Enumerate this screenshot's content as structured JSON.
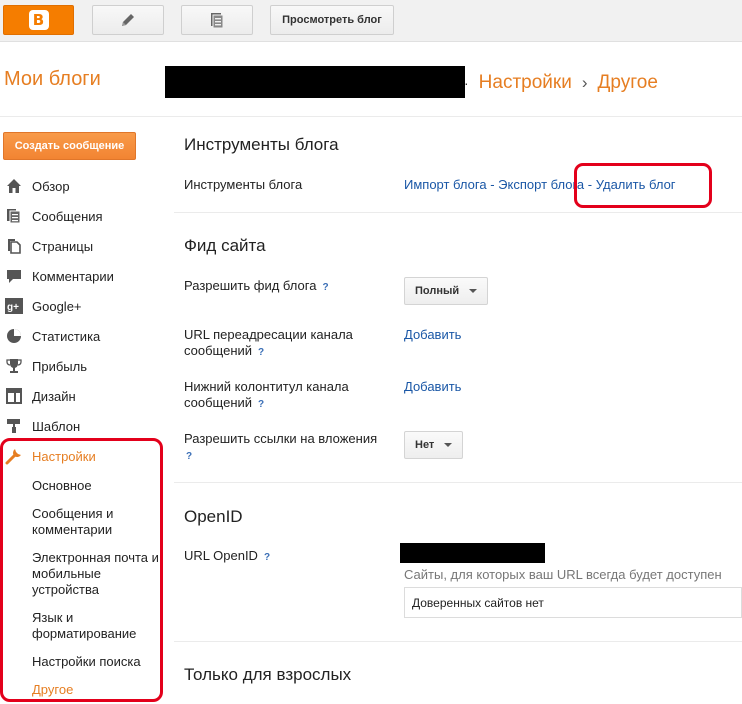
{
  "toolbar": {
    "logo_letter": "B",
    "view_blog_label": "Просмотреть блог"
  },
  "header": {
    "my_blogs": "Мои блоги",
    "breadcrumb": [
      "Настройки",
      "Другое"
    ],
    "breadcrumb_sep": "›",
    "dot": "·"
  },
  "sidebar": {
    "create_post": "Создать сообщение",
    "items": [
      {
        "label": "Обзор",
        "icon": "home-icon"
      },
      {
        "label": "Сообщения",
        "icon": "posts-icon"
      },
      {
        "label": "Страницы",
        "icon": "pages-icon"
      },
      {
        "label": "Комментарии",
        "icon": "comments-icon"
      },
      {
        "label": "Google+",
        "icon": "google-plus-icon"
      },
      {
        "label": "Статистика",
        "icon": "stats-icon"
      },
      {
        "label": "Прибыль",
        "icon": "trophy-icon"
      },
      {
        "label": "Дизайн",
        "icon": "layout-icon"
      },
      {
        "label": "Шаблон",
        "icon": "template-icon"
      },
      {
        "label": "Настройки",
        "icon": "wrench-icon"
      }
    ],
    "sub_items": [
      "Основное",
      "Сообщения и комментарии",
      "Электронная почта и мобильные устройства",
      "Язык и форматирование",
      "Настройки поиска",
      "Другое"
    ]
  },
  "main": {
    "blog_tools": {
      "title": "Инструменты блога",
      "label": "Инструменты блога",
      "import": "Импорт блога",
      "export": "Экспорт блога",
      "delete": "Удалить блог",
      "dash": "-"
    },
    "site_feed": {
      "title": "Фид сайта",
      "allow_feed_label": "Разрешить фид блога",
      "allow_feed_value": "Полный",
      "redirect_label": "URL переадресации канала сообщений",
      "redirect_link": "Добавить",
      "footer_label": "Нижний колонтитул канала сообщений",
      "footer_link": "Добавить",
      "enclosure_label": "Разрешить ссылки на вложения",
      "enclosure_value": "Нет",
      "help": "?"
    },
    "openid": {
      "title": "OpenID",
      "url_label": "URL OpenID",
      "note": "Сайты, для которых ваш URL всегда будет доступен",
      "trusted": "Доверенных сайтов нет",
      "help": "?"
    },
    "adult": {
      "title": "Только для взрослых"
    }
  },
  "colors": {
    "accent": "#e67e22",
    "link": "#1a57a6",
    "highlight": "#e3001b"
  }
}
